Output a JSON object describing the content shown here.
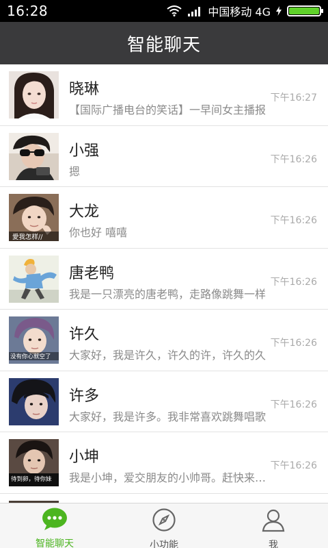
{
  "status_bar": {
    "time": "16:28",
    "carrier": "中国移动 4G",
    "battery_level": 1.0
  },
  "header": {
    "title": "智能聊天"
  },
  "chats": [
    {
      "name": "晓琳",
      "preview": "【国际广播电台的笑话】一早间女主播报",
      "time": "下午16:27"
    },
    {
      "name": "小强",
      "preview": "摁",
      "time": "下午16:26"
    },
    {
      "name": "大龙",
      "preview": "你也好 嘻嘻",
      "time": "下午16:26"
    },
    {
      "name": "唐老鸭",
      "preview": "我是一只漂亮的唐老鸭，走路像跳舞一样",
      "time": "下午16:26"
    },
    {
      "name": "许久",
      "preview": "大家好，我是许久，许久的许，许久的久",
      "time": "下午16:26"
    },
    {
      "name": "许多",
      "preview": "大家好，我是许多。我非常喜欢跳舞唱歌",
      "time": "下午16:26"
    },
    {
      "name": "小坤",
      "preview": "我是小坤，爱交朋友的小帅哥。赶快来加我",
      "time": "下午16:26"
    }
  ],
  "avatar_captions": {
    "dalong": "愛我怎样//",
    "xujiu": "没有你心就空了",
    "xiaokun": "待到卵，待你妹"
  },
  "bottom_nav": {
    "tabs": [
      {
        "label": "智能聊天",
        "icon": "chat-bubble-icon",
        "active": true
      },
      {
        "label": "小功能",
        "icon": "compass-icon",
        "active": false
      },
      {
        "label": "我",
        "icon": "person-icon",
        "active": false
      }
    ]
  },
  "colors": {
    "status_bar": "#000000",
    "title_bar": "#3a3a3c",
    "accent_green": "#4cb520",
    "battery_green": "#5fd22a"
  }
}
